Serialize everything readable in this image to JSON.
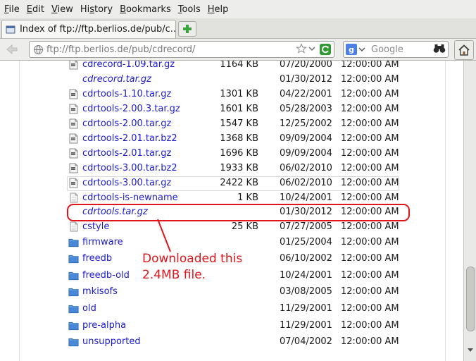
{
  "menubar": {
    "items": [
      "File",
      "Edit",
      "View",
      "History",
      "Bookmarks",
      "Tools",
      "Help"
    ]
  },
  "tab": {
    "title": "Index of ftp://ftp.berlios.de/pub/c...",
    "new_tab_icon": "plus-icon"
  },
  "navbar": {
    "url": "ftp://ftp.berlios.de/pub/cdrecord/",
    "search_placeholder": "Google",
    "search_engine": "google-icon",
    "home_icon": "home-icon"
  },
  "listing": {
    "rows": [
      {
        "name": "cdrecord-1.09.tar.gz",
        "size": "1164 KB",
        "date": "07/20/2000",
        "time": "12:00:00 AM",
        "type": "archive",
        "italic": false
      },
      {
        "name": "cdrecord.tar.gz",
        "size": "",
        "date": "01/30/2012",
        "time": "12:00:00 AM",
        "type": "link",
        "italic": true
      },
      {
        "name": "cdrtools-1.10.tar.gz",
        "size": "1301 KB",
        "date": "04/22/2001",
        "time": "12:00:00 AM",
        "type": "archive",
        "italic": false
      },
      {
        "name": "cdrtools-2.00.3.tar.gz",
        "size": "1601 KB",
        "date": "05/28/2003",
        "time": "12:00:00 AM",
        "type": "archive",
        "italic": false
      },
      {
        "name": "cdrtools-2.00.tar.gz",
        "size": "1547 KB",
        "date": "12/25/2002",
        "time": "12:00:00 AM",
        "type": "archive",
        "italic": false
      },
      {
        "name": "cdrtools-2.01.tar.bz2",
        "size": "1368 KB",
        "date": "09/09/2004",
        "time": "12:00:00 AM",
        "type": "archive",
        "italic": false
      },
      {
        "name": "cdrtools-2.01.tar.gz",
        "size": "1696 KB",
        "date": "09/09/2004",
        "time": "12:00:00 AM",
        "type": "archive",
        "italic": false
      },
      {
        "name": "cdrtools-3.00.tar.bz2",
        "size": "1933 KB",
        "date": "06/02/2010",
        "time": "12:00:00 AM",
        "type": "archive",
        "italic": false
      },
      {
        "name": "cdrtools-3.00.tar.gz",
        "size": "2422 KB",
        "date": "06/02/2010",
        "time": "12:00:00 AM",
        "type": "archive",
        "italic": false,
        "boxed": true
      },
      {
        "name": "cdrtools-is-newname",
        "size": "1 KB",
        "date": "10/24/2001",
        "time": "12:00:00 AM",
        "type": "file",
        "italic": false
      },
      {
        "name": "cdrtools.tar.gz",
        "size": "",
        "date": "01/30/2012",
        "time": "12:00:00 AM",
        "type": "link",
        "italic": true
      },
      {
        "name": "cstyle",
        "size": "25 KB",
        "date": "07/27/2005",
        "time": "12:00:00 AM",
        "type": "file",
        "italic": false
      },
      {
        "name": "firmware",
        "size": "",
        "date": "01/25/2004",
        "time": "12:00:00 AM",
        "type": "folder",
        "italic": false
      },
      {
        "name": "freedb",
        "size": "",
        "date": "06/10/2002",
        "time": "12:00:00 AM",
        "type": "folder",
        "italic": false
      },
      {
        "name": "freedb-old",
        "size": "",
        "date": "10/24/2001",
        "time": "12:00:00 AM",
        "type": "folder",
        "italic": false
      },
      {
        "name": "mkisofs",
        "size": "",
        "date": "03/08/2005",
        "time": "12:00:00 AM",
        "type": "folder",
        "italic": false
      },
      {
        "name": "old",
        "size": "",
        "date": "11/29/2001",
        "time": "12:00:00 AM",
        "type": "folder",
        "italic": false
      },
      {
        "name": "pre-alpha",
        "size": "",
        "date": "11/29/2001",
        "time": "12:00:00 AM",
        "type": "folder",
        "italic": false
      },
      {
        "name": "unsupported",
        "size": "",
        "date": "07/04/2002",
        "time": "12:00:00 AM",
        "type": "folder",
        "italic": false
      }
    ]
  },
  "annotation": {
    "text": "Downloaded this\n2.4MB file.",
    "color": "#e0141a"
  },
  "colors": {
    "link": "#1b1bd1",
    "folder": "#3d7fd0",
    "annotation": "#e0141a"
  }
}
